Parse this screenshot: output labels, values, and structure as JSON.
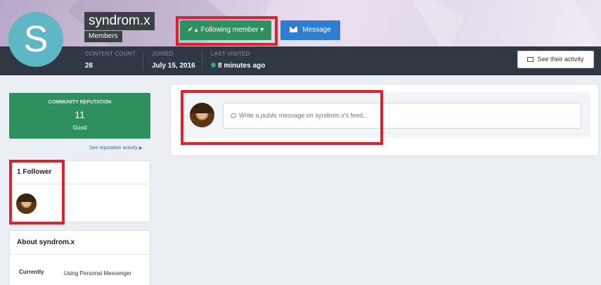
{
  "profile": {
    "avatar_letter": "S",
    "username": "syndrom.x",
    "group": "Members",
    "follow_label": "Following member",
    "message_label": "Message",
    "activity_label": "See their activity"
  },
  "stats": {
    "content_count_label": "CONTENT COUNT",
    "content_count": "26",
    "joined_label": "JOINED",
    "joined": "July 15, 2016",
    "last_visited_label": "LAST VISITED",
    "last_visited": "8 minutes ago"
  },
  "reputation": {
    "title": "COMMUNITY REPUTATION",
    "value": "11",
    "level": "Good",
    "link": "See reputation activity"
  },
  "followers": {
    "title": "1 Follower"
  },
  "about": {
    "title": "About syndrom.x",
    "key": "Currently",
    "value": "Using Personal Messenger"
  },
  "feed": {
    "prefix": "Write a ",
    "emphasis": "public",
    "suffix": " message on syndrom.x's feed..."
  },
  "colors": {
    "accent_green": "#2e8f5f",
    "accent_blue": "#2f7dd1",
    "highlight_red": "#e0202c",
    "online": "#3aa55d"
  }
}
